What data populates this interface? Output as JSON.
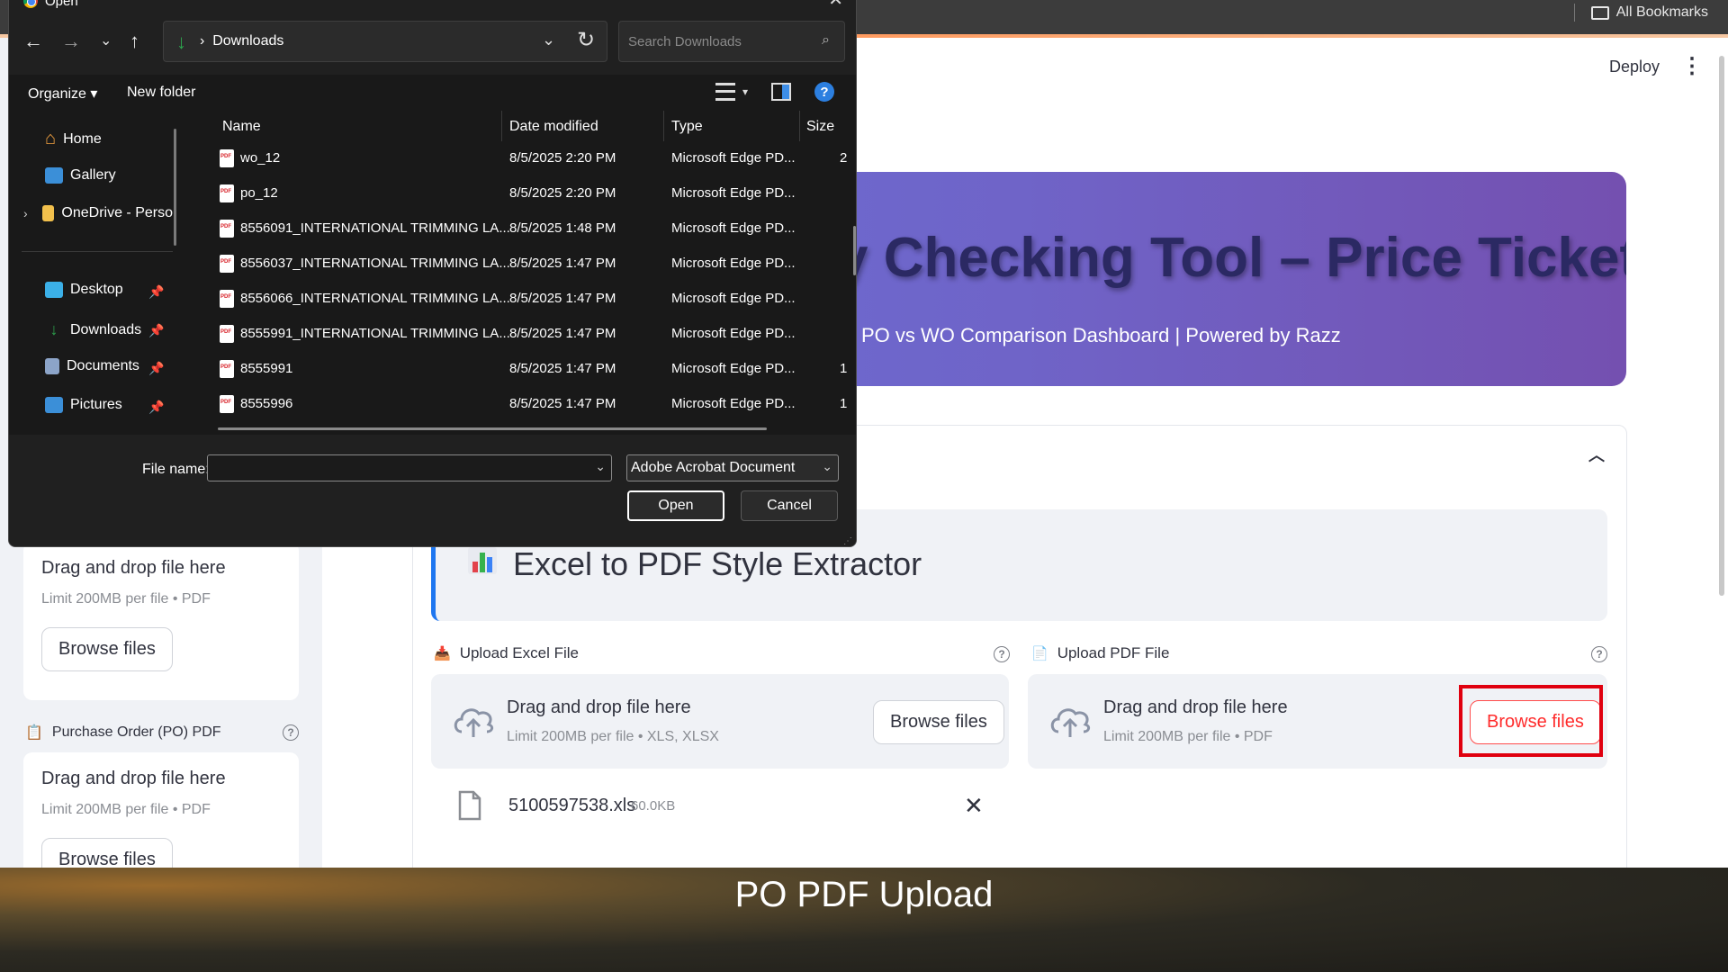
{
  "browser": {
    "bookmarks_label": "All Bookmarks"
  },
  "app": {
    "deploy_label": "Deploy",
    "menu_icon": "kebab-menu-icon",
    "banner_title": "y Checking Tool – Price Tickets",
    "banner_subtitle": "l PO vs WO Comparison Dashboard | Powered by Razz",
    "sidebar": {
      "uploader1": {
        "dd_text": "Drag and drop file here",
        "limit": "Limit 200MB per file • PDF",
        "browse": "Browse files"
      },
      "po_label": "Purchase Order (PO) PDF",
      "uploader2": {
        "dd_text": "Drag and drop file here",
        "limit": "Limit 200MB per file • PDF",
        "browse": "Browse files"
      }
    },
    "extractor_title": "Excel to PDF Style Extractor",
    "excel_upload": {
      "label": "Upload Excel File",
      "dd_text": "Drag and drop file here",
      "limit": "Limit 200MB per file • XLS, XLSX",
      "browse": "Browse files"
    },
    "pdf_upload": {
      "label": "Upload PDF File",
      "dd_text": "Drag and drop file here",
      "limit": "Limit 200MB per file • PDF",
      "browse": "Browse files"
    },
    "uploaded_file": {
      "name": "5100597538.xls",
      "size": "60.0KB"
    },
    "highlight_color": "#e0000f"
  },
  "dialog": {
    "title": "Open",
    "address": {
      "crumb": "Downloads"
    },
    "search_placeholder": "Search Downloads",
    "toolbar": {
      "organize": "Organize",
      "new_folder": "New folder"
    },
    "nav_items": [
      {
        "label": "Home",
        "icon": "home-icon",
        "pinned": false
      },
      {
        "label": "Gallery",
        "icon": "gallery-icon",
        "pinned": false
      },
      {
        "label": "OneDrive - Perso",
        "icon": "folder-icon",
        "pinned": false
      },
      {
        "label": "Desktop",
        "icon": "desktop-icon",
        "pinned": true
      },
      {
        "label": "Downloads",
        "icon": "download-icon",
        "pinned": true
      },
      {
        "label": "Documents",
        "icon": "documents-icon",
        "pinned": true
      },
      {
        "label": "Pictures",
        "icon": "pictures-icon",
        "pinned": true
      }
    ],
    "columns": {
      "name": "Name",
      "date": "Date modified",
      "type": "Type",
      "size": "Size"
    },
    "files": [
      {
        "name": "wo_12",
        "date": "8/5/2025 2:20 PM",
        "type": "Microsoft Edge PD...",
        "size": "2"
      },
      {
        "name": "po_12",
        "date": "8/5/2025 2:20 PM",
        "type": "Microsoft Edge PD...",
        "size": ""
      },
      {
        "name": "8556091_INTERNATIONAL TRIMMING LA...",
        "date": "8/5/2025 1:48 PM",
        "type": "Microsoft Edge PD...",
        "size": ""
      },
      {
        "name": "8556037_INTERNATIONAL TRIMMING LA...",
        "date": "8/5/2025 1:47 PM",
        "type": "Microsoft Edge PD...",
        "size": ""
      },
      {
        "name": "8556066_INTERNATIONAL TRIMMING LA...",
        "date": "8/5/2025 1:47 PM",
        "type": "Microsoft Edge PD...",
        "size": ""
      },
      {
        "name": "8555991_INTERNATIONAL TRIMMING LA...",
        "date": "8/5/2025 1:47 PM",
        "type": "Microsoft Edge PD...",
        "size": ""
      },
      {
        "name": "8555991",
        "date": "8/5/2025 1:47 PM",
        "type": "Microsoft Edge PD...",
        "size": "1"
      },
      {
        "name": "8555996",
        "date": "8/5/2025 1:47 PM",
        "type": "Microsoft Edge PD...",
        "size": "1"
      }
    ],
    "footer": {
      "file_name_label": "File name:",
      "file_name_value": "",
      "file_type": "Adobe Acrobat Document",
      "open": "Open",
      "cancel": "Cancel"
    }
  },
  "caption": "PO PDF Upload"
}
